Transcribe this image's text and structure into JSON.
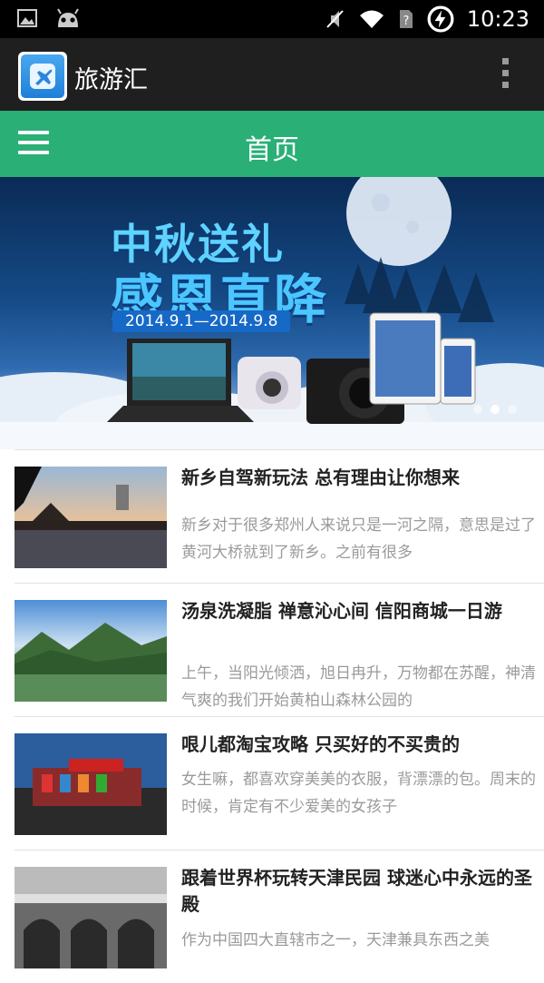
{
  "status_bar": {
    "time": "10:23",
    "left_icons": [
      "image-icon",
      "android-icon"
    ],
    "right_icons": [
      "mute-icon",
      "wifi-icon",
      "no-sim-icon",
      "battery-charging-icon"
    ]
  },
  "action_bar": {
    "app_icon": "airplane-icon",
    "title": "旅游汇",
    "overflow_icon": "overflow-menu-icon"
  },
  "header": {
    "menu_icon": "hamburger-menu-icon",
    "title": "首页",
    "color": "#2aaf77"
  },
  "banner": {
    "line1": "中秋送礼",
    "line2": "感恩直降",
    "date": "2014.9.1—2014.9.8",
    "page_count": 3,
    "active_page": 2
  },
  "articles": [
    {
      "title": "新乡自驾新玩法 总有理由让你想来",
      "desc": "新乡对于很多郑州人来说只是一河之隔，意思是过了黄河大桥就到了新乡。之前有很多",
      "thumb": "lake-pavilion-sunset"
    },
    {
      "title": "汤泉洗凝脂 禅意沁心间 信阳商城一日游",
      "desc": "上午，当阳光倾洒，旭日冉升，万物都在苏醒，神清气爽的我们开始黄柏山森林公园的",
      "thumb": "mountain-lake"
    },
    {
      "title": "哏儿都淘宝攻略 只买好的不买贵的",
      "desc": "女生嘛，都喜欢穿美美的衣服，背漂漂的包。周末的时候，肯定有不少爱美的女孩子",
      "thumb": "shopping-street"
    },
    {
      "title": "跟着世界杯玩转天津民园 球迷心中永远的圣殿",
      "desc": "作为中国四大直辖市之一，天津兼具东西之美",
      "thumb": "stadium-arches"
    }
  ]
}
